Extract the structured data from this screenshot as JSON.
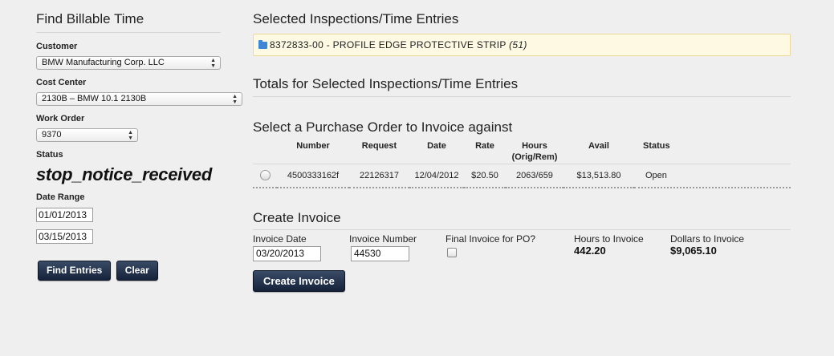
{
  "sidebar": {
    "title": "Find Billable Time",
    "customer": {
      "label": "Customer",
      "value": "BMW Manufacturing Corp. LLC"
    },
    "cost_center": {
      "label": "Cost Center",
      "value": "2130B – BMW 10.1 2130B"
    },
    "work_order": {
      "label": "Work Order",
      "value": "9370"
    },
    "status": {
      "label": "Status",
      "value": "stop_notice_received"
    },
    "date_range": {
      "label": "Date Range",
      "from": "01/01/2013",
      "to": "03/15/2013"
    },
    "find_label": "Find Entries",
    "clear_label": "Clear"
  },
  "selected": {
    "title": "Selected Inspections/Time Entries",
    "item_text": "8372833-00 - PROFILE EDGE PROTECTIVE STRIP",
    "item_count": "(51)"
  },
  "totals": {
    "title": "Totals for Selected Inspections/Time Entries"
  },
  "po": {
    "title": "Select a Purchase Order to Invoice against",
    "headers": {
      "number": "Number",
      "request": "Request",
      "date": "Date",
      "rate": "Rate",
      "hours": "Hours",
      "hours_sub": "(Orig/Rem)",
      "avail": "Avail",
      "status": "Status"
    },
    "rows": [
      {
        "number": "4500333162f",
        "request": "22126317",
        "date": "12/04/2012",
        "rate": "$20.50",
        "hours": "2063/659",
        "avail": "$13,513.80",
        "status": "Open"
      }
    ]
  },
  "invoice": {
    "title": "Create Invoice",
    "date_label": "Invoice Date",
    "date_value": "03/20/2013",
    "number_label": "Invoice Number",
    "number_value": "44530",
    "final_label": "Final Invoice for PO?",
    "hours_label": "Hours to Invoice",
    "hours_value": "442.20",
    "dollars_label": "Dollars to Invoice",
    "dollars_value": "$9,065.10",
    "button_label": "Create Invoice"
  }
}
